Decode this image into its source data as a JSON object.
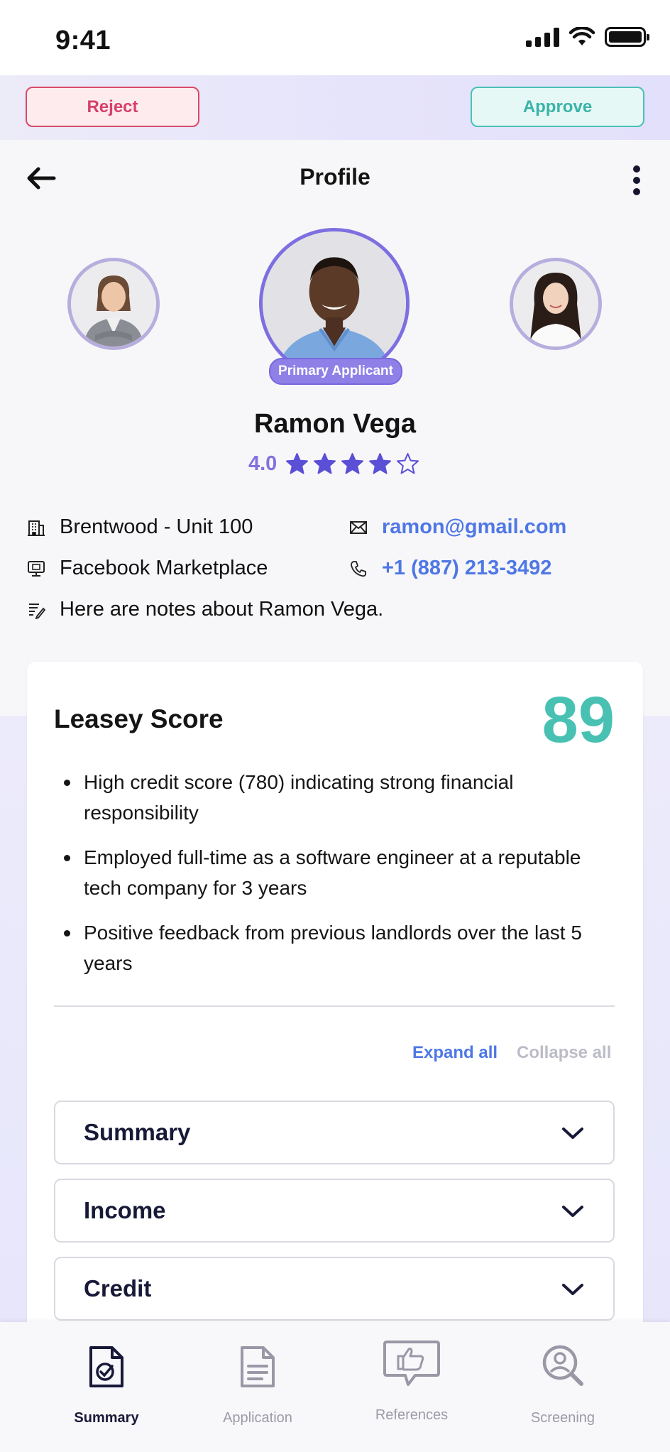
{
  "status_bar": {
    "time": "9:41"
  },
  "actions": {
    "reject_label": "Reject",
    "approve_label": "Approve"
  },
  "header": {
    "title": "Profile"
  },
  "applicants": {
    "primary_badge": "Primary Applicant",
    "name": "Ramon Vega",
    "rating": "4.0",
    "rating_stars": 4,
    "rating_max": 5
  },
  "details": {
    "property": "Brentwood - Unit 100",
    "source": "Facebook Marketplace",
    "notes": "Here are notes about Ramon Vega.",
    "email": "ramon@gmail.com",
    "phone": "+1 (887) 213-3492"
  },
  "score_card": {
    "title": "Leasey Score",
    "score": "89",
    "bullets": [
      "High credit score (780) indicating strong financial responsibility",
      "Employed full-time as a software engineer at a reputable tech company for 3 years",
      "Positive feedback from previous landlords over the last 5 years"
    ],
    "expand_all": "Expand all",
    "collapse_all": "Collapse all",
    "sections": [
      "Summary",
      "Income",
      "Credit"
    ]
  },
  "bottom_nav": [
    {
      "label": "Summary",
      "icon": "summary-document-icon",
      "active": true
    },
    {
      "label": "Application",
      "icon": "application-document-icon",
      "active": false
    },
    {
      "label": "References",
      "icon": "references-thumbs-up-icon",
      "active": false
    },
    {
      "label": "Screening",
      "icon": "screening-search-icon",
      "active": false
    }
  ],
  "colors": {
    "accent": "#7d6fe0",
    "reject": "#d94a6a",
    "approve": "#49c1b6",
    "score": "#48c1b3",
    "link": "#4f77e5"
  }
}
